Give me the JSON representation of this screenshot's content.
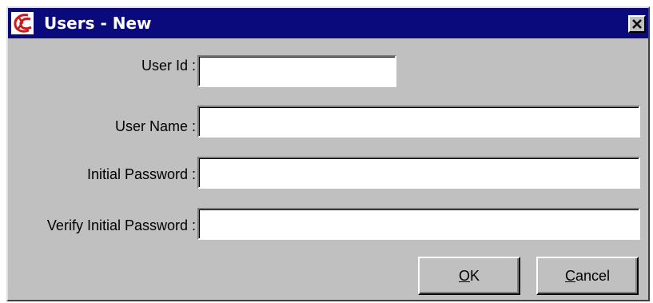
{
  "window": {
    "title": "Users - New",
    "app_icon": "app-logo-icon",
    "close_icon": "close-icon",
    "colors": {
      "titlebar": "#0a0a7c",
      "face": "#c0c0c0",
      "logo": "#cc1a1a"
    }
  },
  "form": {
    "user_id": {
      "label": "User Id :",
      "value": ""
    },
    "user_name": {
      "label": "User Name :",
      "value": ""
    },
    "initial_password": {
      "label": "Initial Password :",
      "value": ""
    },
    "verify_password": {
      "label": "Verify Initial Password :",
      "value": ""
    }
  },
  "buttons": {
    "ok": {
      "mnemonic": "O",
      "rest": "K"
    },
    "cancel": {
      "mnemonic": "C",
      "rest": "ancel"
    }
  }
}
